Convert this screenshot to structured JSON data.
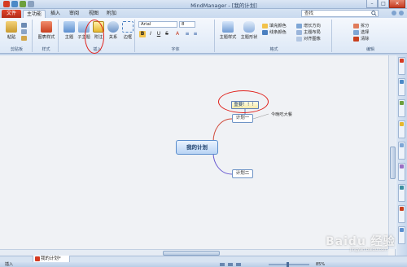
{
  "window": {
    "title": "MindManager - [我的计划]"
  },
  "tabs": {
    "file": "文件",
    "home": "主功能",
    "insert": "插入",
    "review": "审阅",
    "view": "视图",
    "help": "附加"
  },
  "search": {
    "placeholder": "查找"
  },
  "ribbon": {
    "groups": {
      "clipboard": "剪贴板",
      "style": "样式",
      "insert": "插入",
      "font": "字体",
      "format": "格式",
      "edit": "编辑"
    },
    "buttons": {
      "paste": "粘贴",
      "map_style": "图表样式",
      "topic": "主题",
      "subtopic": "子主题",
      "callout": "附注",
      "relationship": "关系",
      "boundary": "边框",
      "topic_style": "主题样式",
      "topic_shape": "主题形状",
      "fill_color": "填充颜色",
      "line_color": "线条颜色",
      "growth_direction": "增长方向",
      "layout": "主题布局",
      "align": "对齐图像",
      "split": "拆分",
      "select": "选择",
      "clear": "清除"
    },
    "font_name": "Arial",
    "font_size": "8"
  },
  "map": {
    "central_topic": "我的计划",
    "topic_1": "计划一",
    "topic_2": "计划二",
    "callout": "重要！！！",
    "note": "今晚吃大餐"
  },
  "document_tab": "我的计划*",
  "status": {
    "mode": "插入",
    "zoom": "85%"
  },
  "watermark": {
    "main": "Baidu 经验",
    "sub": "jingyan.baidu.com"
  },
  "colors": {
    "accent_red": "#e0201a",
    "file_tab": "#d53b22",
    "topic_border": "#6e94c6",
    "central_fill": "#b9d4f4"
  }
}
